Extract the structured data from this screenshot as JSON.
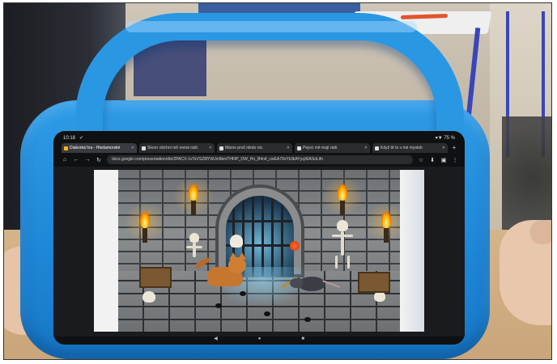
{
  "status_bar": {
    "time": "10:18",
    "check_glyph": "✔",
    "battery": "▾▼ 75 %"
  },
  "browser": {
    "tabs": [
      {
        "title": "Diakorká hra - Hledamorské",
        "favicon": "slides-icon",
        "active": true
      },
      {
        "title": "Skoro všichni mě nemá rádi.",
        "favicon": "forms-icon",
        "active": false
      },
      {
        "title": "Mámo proč nikdo nic.",
        "favicon": "forms-icon",
        "active": false
      },
      {
        "title": "Pejsci mě mají rádi.",
        "favicon": "forms-icon",
        "active": false
      },
      {
        "title": "Když tě to v mé mysleb",
        "favicon": "forms-icon",
        "active": false
      }
    ],
    "tab_close_glyph": "✕",
    "new_tab_glyph": "+",
    "url": "docs.google.com/presentation/d/e/2PACX-1vTsVSZ8lYWJm9kmTHFtP_OW_Hn_B4n4_cwEA79vYk3kAYyqXliASoLifn",
    "toolbar_icons": [
      "home-icon",
      "back-icon",
      "forward-icon",
      "reload-icon",
      "star-icon",
      "download-icon",
      "tabs-icon",
      "menu-icon"
    ]
  },
  "nav_bar": {
    "back": "◀",
    "home": "●",
    "recents": "■"
  },
  "colors": {
    "case_blue": "#1e86d6",
    "flame": "#ffb300"
  }
}
